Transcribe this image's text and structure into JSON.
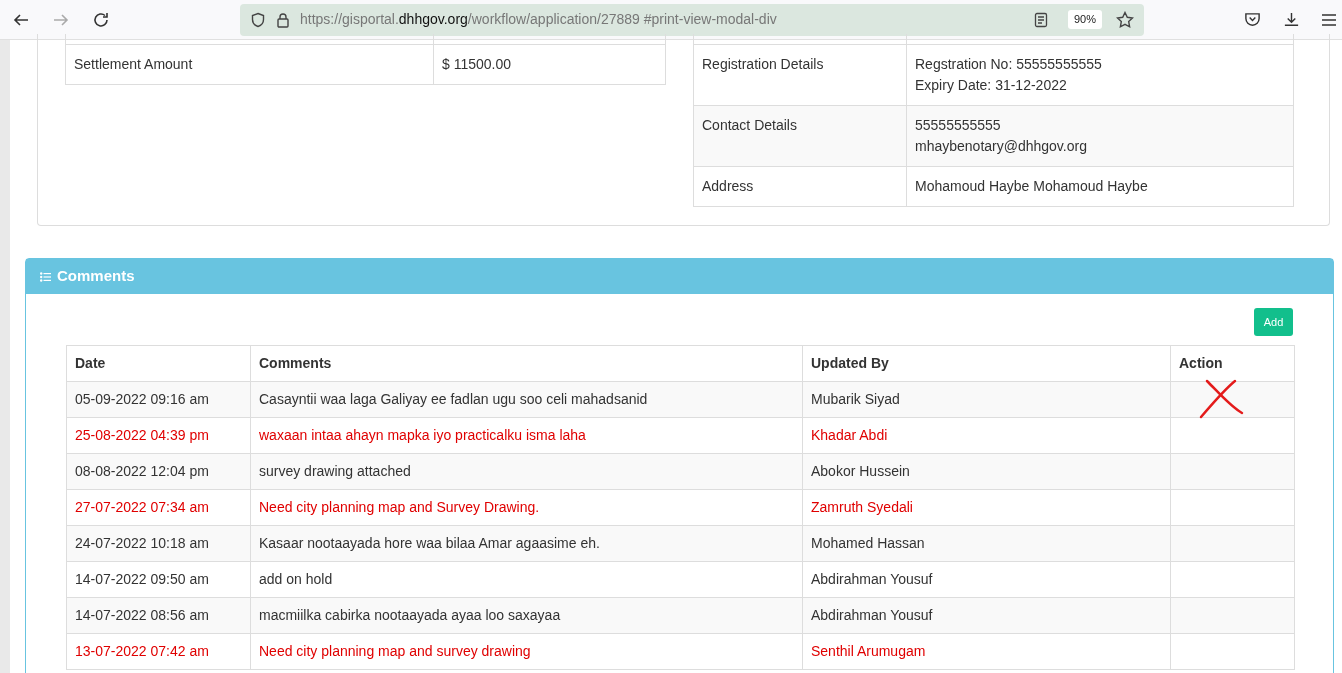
{
  "browser": {
    "url_host_prefix": "https://gisportal.",
    "url_host": "dhhgov.org",
    "url_path": "/workflow/application/27889 #print-view-modal-div",
    "zoom": "90%"
  },
  "payment_table": {
    "rows": [
      {
        "label": "Settlement Amount",
        "value": "$ 11500.00"
      }
    ]
  },
  "notary_table": {
    "rows": [
      {
        "label": "Registration Details",
        "lines": [
          "Regstration No: 55555555555",
          "Expiry Date: 31-12-2022"
        ]
      },
      {
        "label": "Contact Details",
        "lines": [
          "55555555555",
          "mhaybenotary@dhhgov.org"
        ]
      },
      {
        "label": "Address",
        "lines": [
          "Mohamoud Haybe Mohamoud Haybe"
        ]
      }
    ]
  },
  "comments": {
    "title": "Comments",
    "add_button": "Add",
    "columns": [
      "Date",
      "Comments",
      "Updated By",
      "Action"
    ],
    "rows": [
      {
        "date": "05-09-2022 09:16 am",
        "comment": "Casayntii waa laga Galiyay ee fadlan ugu soo celi mahadsanid",
        "updated_by": "Mubarik Siyad",
        "highlighted": false,
        "crossed_out": true
      },
      {
        "date": "25-08-2022 04:39 pm",
        "comment": "waxaan intaa ahayn mapka iyo practicalku isma laha",
        "updated_by": "Khadar Abdi",
        "highlighted": true,
        "crossed_out": false
      },
      {
        "date": "08-08-2022 12:04 pm",
        "comment": "survey drawing attached",
        "updated_by": "Abokor Hussein",
        "highlighted": false,
        "crossed_out": false
      },
      {
        "date": "27-07-2022 07:34 am",
        "comment": "Need city planning map and Survey Drawing.",
        "updated_by": "Zamruth Syedali",
        "highlighted": true,
        "crossed_out": false
      },
      {
        "date": "24-07-2022 10:18 am",
        "comment": "Kasaar nootaayada hore waa bilaa Amar agaasime eh.",
        "updated_by": "Mohamed Hassan",
        "highlighted": false,
        "crossed_out": false
      },
      {
        "date": "14-07-2022 09:50 am",
        "comment": "add on hold",
        "updated_by": "Abdirahman Yousuf",
        "highlighted": false,
        "crossed_out": false
      },
      {
        "date": "14-07-2022 08:56 am",
        "comment": "macmiilka cabirka nootaayada ayaa loo saxayaa",
        "updated_by": "Abdirahman Yousuf",
        "highlighted": false,
        "crossed_out": false
      },
      {
        "date": "13-07-2022 07:42 am",
        "comment": "Need city planning map and survey drawing",
        "updated_by": "Senthil Arumugam",
        "highlighted": true,
        "crossed_out": false
      }
    ]
  }
}
